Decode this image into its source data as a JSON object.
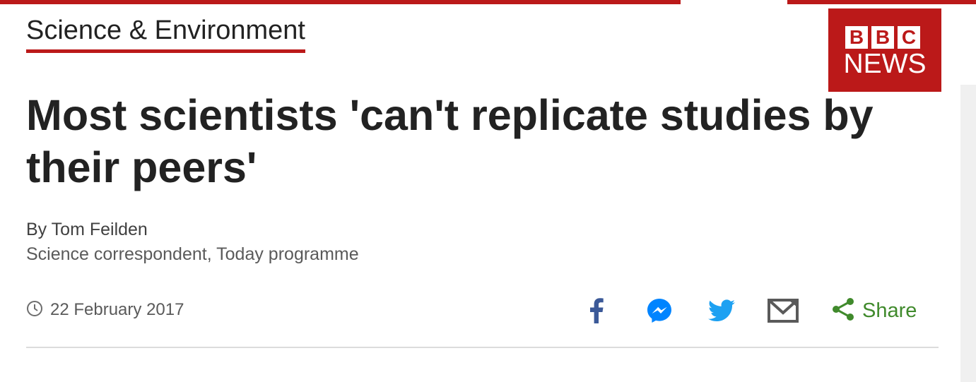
{
  "section": {
    "label": "Science & Environment"
  },
  "logo": {
    "letters": [
      "B",
      "B",
      "C"
    ],
    "news": "NEWS",
    "brand_color": "#bb1919"
  },
  "article": {
    "headline": "Most scientists 'can't replicate studies by their peers'",
    "author": "By Tom Feilden",
    "role": "Science correspondent, Today programme",
    "date": "22 February 2017"
  },
  "share": {
    "label": "Share",
    "icons": [
      "facebook-icon",
      "messenger-icon",
      "twitter-icon",
      "email-icon",
      "share-icon"
    ],
    "share_color": "#408a2c",
    "facebook_color": "#3b5998",
    "messenger_color": "#0084ff",
    "twitter_color": "#1da1f2"
  }
}
